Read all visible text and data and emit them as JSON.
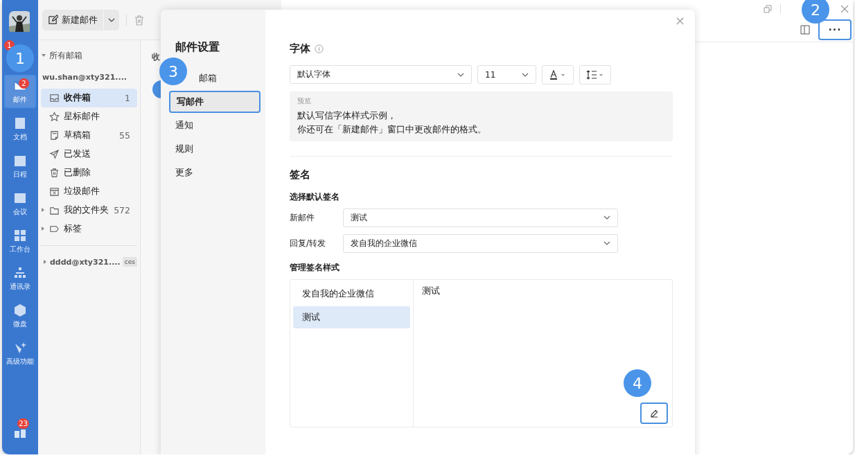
{
  "rail": {
    "items": [
      {
        "badge": "1"
      },
      {
        "label": "邮件",
        "badge": "2",
        "selected": true,
        "highlighted": true,
        "callout": "1"
      },
      {
        "label": "文档",
        "selected": false
      },
      {
        "label": "日程",
        "selected": false
      },
      {
        "label": "会议",
        "selected": false
      },
      {
        "label": "工作台",
        "selected": false
      },
      {
        "label": "通讯录",
        "selected": false
      },
      {
        "label": "微盘",
        "selected": false
      },
      {
        "label": "高级功能",
        "selected": false
      }
    ],
    "bottom": {
      "badge": "23"
    }
  },
  "toolbar": {
    "new_mail": "新建邮件"
  },
  "sidebar": {
    "header": "所有邮箱",
    "accounts": [
      {
        "address": "wu.shan@xty321....",
        "folders": [
          {
            "name": "收件箱",
            "count": "1",
            "selected": true
          },
          {
            "name": "星标邮件",
            "selected": false
          },
          {
            "name": "草稿箱",
            "count": "55",
            "selected": false
          },
          {
            "name": "已发送",
            "selected": false
          },
          {
            "name": "已删除",
            "selected": false
          },
          {
            "name": "垃圾邮件",
            "selected": false
          },
          {
            "name": "我的文件夹",
            "count": "572",
            "selected": false,
            "expanded": false
          },
          {
            "name": "标签",
            "selected": false,
            "expanded": false
          }
        ]
      },
      {
        "address": "dddd@xty321....",
        "tag": "ces",
        "expanded": false
      }
    ]
  },
  "list": {
    "header": "收"
  },
  "window_controls": {
    "more": {
      "label": "···",
      "highlighted": true,
      "callout": "2"
    }
  },
  "settings": {
    "title": "邮件设置",
    "close": "×",
    "nav": [
      {
        "label": "邮箱",
        "selected": false
      },
      {
        "label": "写邮件",
        "selected": true,
        "highlighted": true,
        "callout": "3"
      },
      {
        "label": "通知",
        "selected": false
      },
      {
        "label": "规则",
        "selected": false
      },
      {
        "label": "更多",
        "selected": false
      }
    ],
    "font": {
      "heading": "字体",
      "family": "默认字体",
      "size": "11",
      "preview_label": "预览",
      "preview_lines": [
        "默认写信字体样式示例，",
        "你还可在「新建邮件」窗口中更改邮件的格式。"
      ]
    },
    "signature": {
      "heading": "签名",
      "default_heading": "选择默认签名",
      "defaults": [
        {
          "label": "新邮件",
          "value": "测试"
        },
        {
          "label": "回复/转发",
          "value": "发自我的企业微信"
        }
      ],
      "manage_heading": "管理签名样式",
      "styles": [
        {
          "name": "发自我的企业微信",
          "selected": false
        },
        {
          "name": "测试",
          "selected": true
        }
      ],
      "preview": "测试",
      "edit": {
        "highlighted": true,
        "callout": "4"
      }
    }
  }
}
